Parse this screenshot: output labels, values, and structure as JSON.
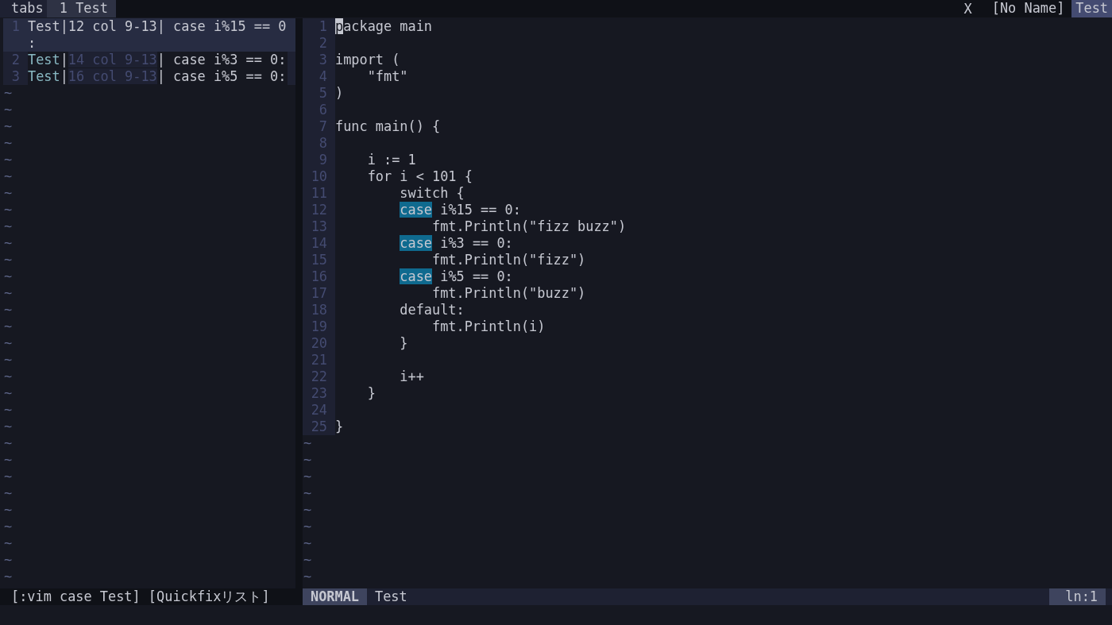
{
  "tabline": {
    "label": "tabs",
    "tabs": [
      {
        "label": " 1 Test",
        "selected": true
      }
    ],
    "close": "X",
    "buffers": [
      {
        "label": "[No Name]",
        "selected": false
      },
      {
        "label": "Test",
        "selected": true
      }
    ]
  },
  "quickfix": {
    "separator": "|",
    "items": [
      {
        "number": "1",
        "file": "Test",
        "location": "12 col 9-13",
        "text": " case i%15 == 0:",
        "selected": true
      },
      {
        "number": "2",
        "file": "Test",
        "location": "14 col 9-13",
        "text": " case i%3 == 0:",
        "selected": false
      },
      {
        "number": "3",
        "file": "Test",
        "location": "16 col 9-13",
        "text": " case i%5 == 0:",
        "selected": false
      }
    ],
    "filler": [
      "~",
      "~",
      "~",
      "~",
      "~",
      "~",
      "~",
      "~",
      "~",
      "~",
      "~",
      "~",
      "~",
      "~",
      "~",
      "~",
      "~",
      "~",
      "~",
      "~",
      "~",
      "~",
      "~",
      "~",
      "~",
      "~",
      "~",
      "~",
      "~",
      "~"
    ],
    "status": "[:vim case Test] [Quickfixリスト]"
  },
  "editor": {
    "lines": [
      {
        "number": "1",
        "segments": [
          {
            "kind": "cursor",
            "text": "p"
          },
          {
            "kind": "plain",
            "text": "ackage main"
          }
        ]
      },
      {
        "number": "2"
      },
      {
        "number": "3",
        "segments": [
          {
            "kind": "plain",
            "text": "import ("
          }
        ]
      },
      {
        "number": "4",
        "segments": [
          {
            "kind": "plain",
            "text": "    \"fmt\""
          }
        ]
      },
      {
        "number": "5",
        "segments": [
          {
            "kind": "plain",
            "text": ")"
          }
        ]
      },
      {
        "number": "6"
      },
      {
        "number": "7",
        "segments": [
          {
            "kind": "plain",
            "text": "func main() {"
          }
        ]
      },
      {
        "number": "8"
      },
      {
        "number": "9",
        "segments": [
          {
            "kind": "plain",
            "text": "    i := 1"
          }
        ]
      },
      {
        "number": "10",
        "segments": [
          {
            "kind": "plain",
            "text": "    for i < 101 {"
          }
        ]
      },
      {
        "number": "11",
        "segments": [
          {
            "kind": "plain",
            "text": "        switch {"
          }
        ]
      },
      {
        "number": "12",
        "segments": [
          {
            "kind": "match",
            "text": "        case"
          },
          {
            "kind": "plain",
            "text": " i%15 == 0:"
          }
        ]
      },
      {
        "number": "13",
        "segments": [
          {
            "kind": "plain",
            "text": "            fmt.Println(\"fizz buzz\")"
          }
        ]
      },
      {
        "number": "14",
        "segments": [
          {
            "kind": "match",
            "text": "        case"
          },
          {
            "kind": "plain",
            "text": " i%3 == 0:"
          }
        ]
      },
      {
        "number": "15",
        "segments": [
          {
            "kind": "plain",
            "text": "            fmt.Println(\"fizz\")"
          }
        ]
      },
      {
        "number": "16",
        "segments": [
          {
            "kind": "match",
            "text": "        case"
          },
          {
            "kind": "plain",
            "text": " i%5 == 0:"
          }
        ]
      },
      {
        "number": "17",
        "segments": [
          {
            "kind": "plain",
            "text": "            fmt.Println(\"buzz\")"
          }
        ]
      },
      {
        "number": "18",
        "segments": [
          {
            "kind": "plain",
            "text": "        default:"
          }
        ]
      },
      {
        "number": "19",
        "segments": [
          {
            "kind": "plain",
            "text": "            fmt.Println(i)"
          }
        ]
      },
      {
        "number": "20",
        "segments": [
          {
            "kind": "plain",
            "text": "        }"
          }
        ]
      },
      {
        "number": "21"
      },
      {
        "number": "22",
        "segments": [
          {
            "kind": "plain",
            "text": "        i++"
          }
        ]
      },
      {
        "number": "23",
        "segments": [
          {
            "kind": "plain",
            "text": "    }"
          }
        ]
      },
      {
        "number": "24"
      },
      {
        "number": "25",
        "segments": [
          {
            "kind": "plain",
            "text": "}"
          }
        ]
      }
    ],
    "filler": [
      "~",
      "~",
      "~",
      "~",
      "~",
      "~",
      "~",
      "~",
      "~"
    ],
    "mode": "NORMAL",
    "file": "Test",
    "position": "ln:1"
  }
}
